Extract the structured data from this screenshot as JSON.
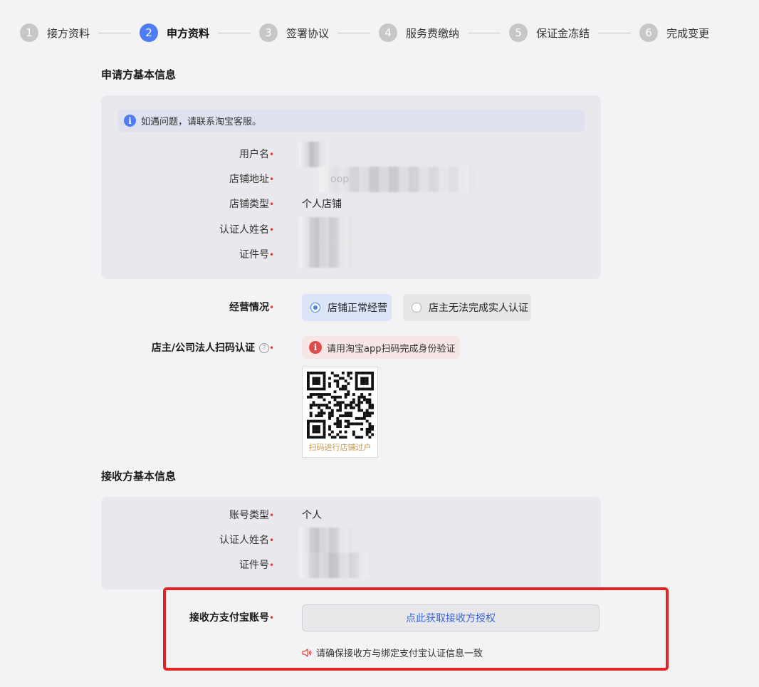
{
  "steps": [
    {
      "num": "1",
      "label": "接方资料",
      "active": false
    },
    {
      "num": "2",
      "label": "申方资料",
      "active": true
    },
    {
      "num": "3",
      "label": "签署协议",
      "active": false
    },
    {
      "num": "4",
      "label": "服务费缴纳",
      "active": false
    },
    {
      "num": "5",
      "label": "保证金冻结",
      "active": false
    },
    {
      "num": "6",
      "label": "完成变更",
      "active": false
    }
  ],
  "applicant": {
    "title": "申请方基本信息",
    "notice": "如遇问题，请联系淘宝客服。",
    "fields": {
      "username": {
        "label": "用户名"
      },
      "shop_url": {
        "label": "店铺地址",
        "value_partial": "oop"
      },
      "shop_type": {
        "label": "店铺类型",
        "value": "个人店铺"
      },
      "cert_name": {
        "label": "认证人姓名"
      },
      "id_no": {
        "label": "证件号"
      }
    },
    "business": {
      "label": "经营情况",
      "options": [
        "店铺正常经营",
        "店主无法完成实人认证"
      ],
      "selected": "店铺正常经营"
    },
    "scan": {
      "label": "店主/公司法人扫码认证",
      "help": "?",
      "alert": "请用淘宝app扫码完成身份验证",
      "qr_caption": "扫码进行店铺过户"
    }
  },
  "receiver": {
    "title": "接收方基本信息",
    "fields": {
      "account_type": {
        "label": "账号类型",
        "value": "个人"
      },
      "cert_name": {
        "label": "认证人姓名"
      },
      "id_no": {
        "label": "证件号"
      }
    },
    "alipay": {
      "label": "接收方支付宝账号",
      "button": "点此获取接收方授权",
      "tip": "请确保接收方与绑定支付宝认证信息一致"
    }
  },
  "required_mark": "•",
  "info_glyph": "i",
  "colors": {
    "primary": "#4d7cf5",
    "required": "#e03e3e",
    "highlight": "#e02424",
    "link": "#3b64d8"
  }
}
